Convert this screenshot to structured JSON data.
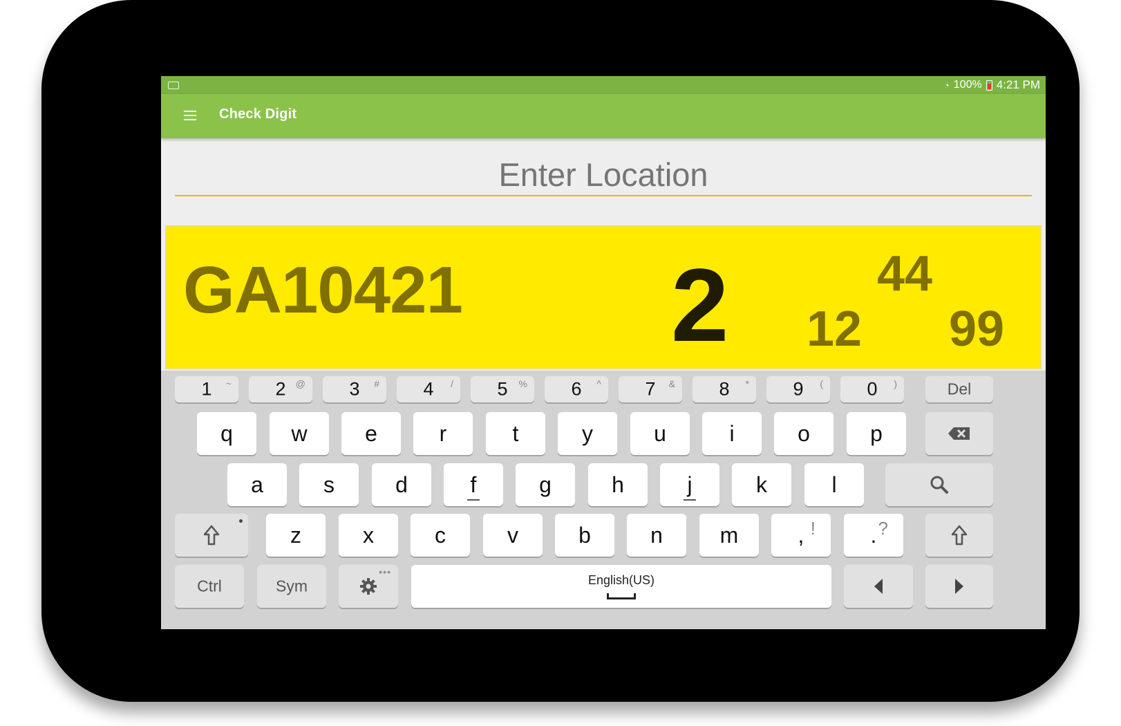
{
  "status_bar": {
    "battery": "100%",
    "time": "4:21 PM"
  },
  "app_bar": {
    "title": "Check Digit",
    "menu_icon": "hamburger-menu-icon"
  },
  "location_input": {
    "placeholder": "Enter Location",
    "value": ""
  },
  "result": {
    "location_code": "GA10421",
    "check_digit": "2",
    "left_value": "12",
    "top_value": "44",
    "right_value": "99"
  },
  "colors": {
    "status_bar": "#7cb342",
    "app_bar": "#8bc34a",
    "result_bg": "#ffea00",
    "underline": "#f4b400"
  },
  "keyboard": {
    "number_row": [
      {
        "main": "1",
        "sub": "~"
      },
      {
        "main": "2",
        "sub": "@"
      },
      {
        "main": "3",
        "sub": "#"
      },
      {
        "main": "4",
        "sub": "/"
      },
      {
        "main": "5",
        "sub": "%"
      },
      {
        "main": "6",
        "sub": "^"
      },
      {
        "main": "7",
        "sub": "&"
      },
      {
        "main": "8",
        "sub": "*"
      },
      {
        "main": "9",
        "sub": "("
      },
      {
        "main": "0",
        "sub": ")"
      }
    ],
    "del_label": "Del",
    "row1": [
      "q",
      "w",
      "e",
      "r",
      "t",
      "y",
      "u",
      "i",
      "o",
      "p"
    ],
    "row2": [
      "a",
      "s",
      "d",
      "f",
      "g",
      "h",
      "j",
      "k",
      "l"
    ],
    "row3": [
      "z",
      "x",
      "c",
      "v",
      "b",
      "n",
      "m"
    ],
    "comma": {
      "main": ",",
      "sub": "!"
    },
    "period": {
      "main": ".",
      "sub": "?"
    },
    "ctrl_label": "Ctrl",
    "sym_label": "Sym",
    "space_label": "English(US)",
    "icons": [
      "backspace-icon",
      "search-icon",
      "shift-icon",
      "gear-icon",
      "arrow-left-icon",
      "arrow-right-icon"
    ]
  }
}
